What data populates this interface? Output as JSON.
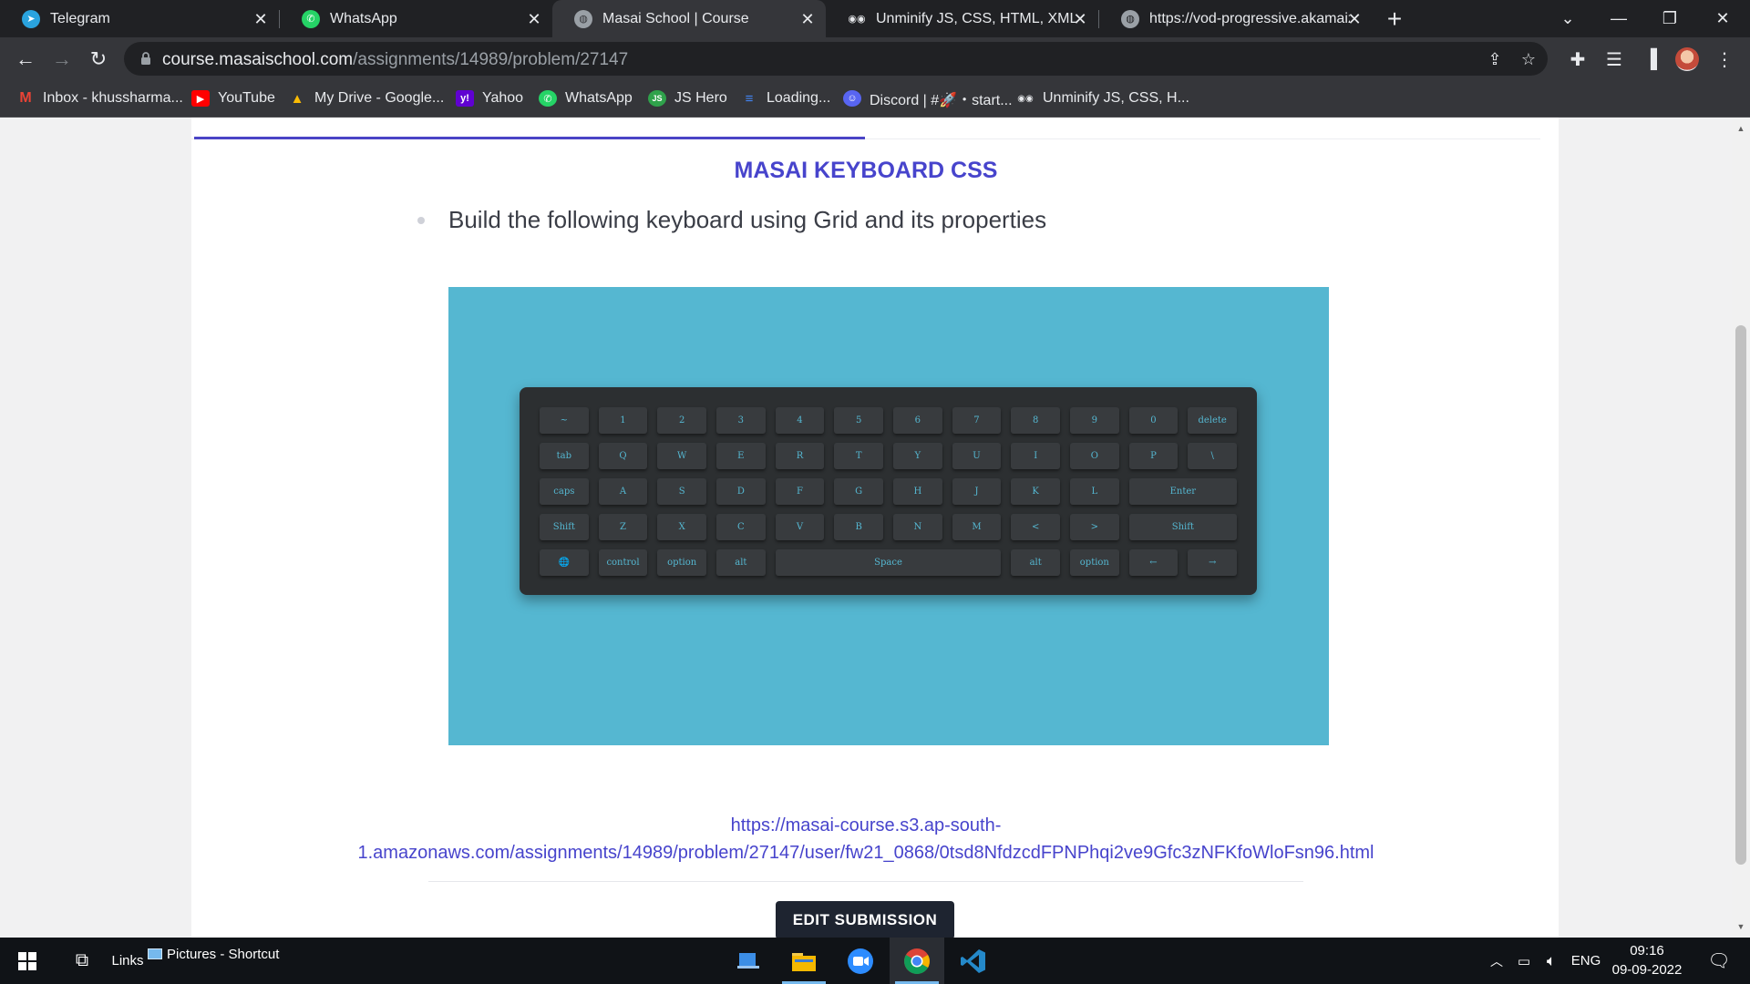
{
  "browser": {
    "tabs": [
      {
        "title": "Telegram",
        "icon": "telegram-icon",
        "color": "#2aa3de"
      },
      {
        "title": "WhatsApp",
        "icon": "whatsapp-icon",
        "color": "#25d366"
      },
      {
        "title": "Masai School | Course",
        "icon": "globe-icon",
        "color": "#9aa0a6"
      },
      {
        "title": "Unminify JS, CSS, HTML, XML and",
        "icon": "unminify-icon",
        "color": "#e8eaed"
      },
      {
        "title": "https://vod-progressive.akamaize",
        "icon": "globe-icon",
        "color": "#9aa0a6"
      }
    ],
    "url_domain": "course.masaischool.com",
    "url_path": "/assignments/14989/problem/27147",
    "bookmarks": [
      {
        "label": "Inbox - khussharma...",
        "icon": "gmail-icon",
        "color": "#ea4335"
      },
      {
        "label": "YouTube",
        "icon": "youtube-icon",
        "color": "#ff0000"
      },
      {
        "label": "My Drive - Google...",
        "icon": "google-drive-icon",
        "color": "#fbbc04"
      },
      {
        "label": "Yahoo",
        "icon": "yahoo-icon",
        "color": "#6001d2"
      },
      {
        "label": "WhatsApp",
        "icon": "whatsapp-icon",
        "color": "#25d366"
      },
      {
        "label": "JS Hero",
        "icon": "js-hero-icon",
        "color": "#2fa24b"
      },
      {
        "label": "Loading...",
        "icon": "loading-icon",
        "color": "#4285f4"
      },
      {
        "label": "Discord | #🚀・start...",
        "icon": "discord-icon",
        "color": "#5865f2"
      },
      {
        "label": "Unminify JS, CSS, H...",
        "icon": "unminify-icon",
        "color": "#e8eaed"
      }
    ]
  },
  "page": {
    "title": "MASAI KEYBOARD CSS",
    "instruction": "Build the following keyboard using Grid and its properties",
    "keyboard": {
      "rows": [
        [
          {
            "k": "~"
          },
          {
            "k": "1"
          },
          {
            "k": "2"
          },
          {
            "k": "3"
          },
          {
            "k": "4"
          },
          {
            "k": "5"
          },
          {
            "k": "6"
          },
          {
            "k": "7"
          },
          {
            "k": "8"
          },
          {
            "k": "9"
          },
          {
            "k": "0"
          },
          {
            "k": "delete"
          }
        ],
        [
          {
            "k": "tab"
          },
          {
            "k": "Q"
          },
          {
            "k": "W"
          },
          {
            "k": "E"
          },
          {
            "k": "R"
          },
          {
            "k": "T"
          },
          {
            "k": "Y"
          },
          {
            "k": "U"
          },
          {
            "k": "I"
          },
          {
            "k": "O"
          },
          {
            "k": "P"
          },
          {
            "k": "\\"
          }
        ],
        [
          {
            "k": "caps"
          },
          {
            "k": "A"
          },
          {
            "k": "S"
          },
          {
            "k": "D"
          },
          {
            "k": "F"
          },
          {
            "k": "G"
          },
          {
            "k": "H"
          },
          {
            "k": "J"
          },
          {
            "k": "K"
          },
          {
            "k": "L"
          },
          {
            "k": "Enter",
            "span": 2
          }
        ],
        [
          {
            "k": "Shift"
          },
          {
            "k": "Z"
          },
          {
            "k": "X"
          },
          {
            "k": "C"
          },
          {
            "k": "V"
          },
          {
            "k": "B"
          },
          {
            "k": "N"
          },
          {
            "k": "M"
          },
          {
            "k": "<"
          },
          {
            "k": ">"
          },
          {
            "k": "Shift",
            "span": 2
          }
        ],
        [
          {
            "k": "🌐"
          },
          {
            "k": "control"
          },
          {
            "k": "option"
          },
          {
            "k": "alt"
          },
          {
            "k": "Space",
            "span": 4
          },
          {
            "k": "alt"
          },
          {
            "k": "option"
          },
          {
            "k": "←"
          },
          {
            "k": "→"
          }
        ]
      ],
      "colors": {
        "background": "#55b7d1",
        "board": "#2c2f31",
        "key": "#383b3e",
        "key_text": "#55b7d1"
      }
    },
    "submission_link_line1": "https://masai-course.s3.ap-south-",
    "submission_link_line2": "1.amazonaws.com/assignments/14989/problem/27147/user/fw21_0868/0tsd8NfdzcdFPNPhqi2ve9Gfc3zNFKfoWloFsn96.html",
    "edit_button": "EDIT SUBMISSION",
    "accent_color": "#4744cc"
  },
  "taskbar": {
    "links_label": "Links",
    "pictures_label": "Pictures - Shortcut",
    "language": "ENG",
    "time": "09:16",
    "date": "09-09-2022",
    "apps": [
      {
        "name": "file-manager-app-icon"
      },
      {
        "name": "file-explorer-icon"
      },
      {
        "name": "zoom-icon"
      },
      {
        "name": "chrome-icon"
      },
      {
        "name": "vscode-icon"
      }
    ]
  }
}
